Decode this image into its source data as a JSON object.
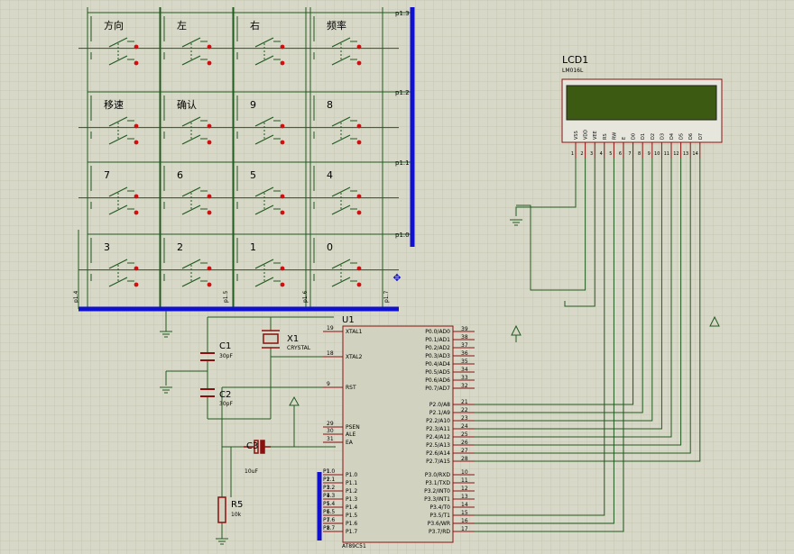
{
  "colors": {
    "background": "#d8d8c8",
    "grid": "#c6c6b4",
    "wire": "#1f5a1f",
    "bus": "#1010d0",
    "component": "#8a1010",
    "chip_fill": "#d2d2c0",
    "lcd_frame": "#e6e6dc",
    "lcd_screen": "#3d5a12",
    "contact": "#d01010"
  },
  "keypad": {
    "keys": [
      [
        "方向",
        "左",
        "右",
        "频率"
      ],
      [
        "移速",
        "确认",
        "9",
        "8"
      ],
      [
        "7",
        "6",
        "5",
        "4"
      ],
      [
        "3",
        "2",
        "1",
        "0"
      ]
    ],
    "row_nets": [
      "p1.3",
      "p1.2",
      "p1.1",
      "p1.0"
    ],
    "col_nets": [
      "p1.4",
      "p1.5",
      "p1.6",
      "p1.7"
    ]
  },
  "lcd": {
    "ref": "LCD1",
    "part": "LM016L",
    "pins": [
      "VSS",
      "VDD",
      "VEE",
      "RS",
      "RW",
      "E",
      "D0",
      "D1",
      "D2",
      "D3",
      "D4",
      "D5",
      "D6",
      "D7"
    ],
    "pin_numbers": [
      "1",
      "2",
      "3",
      "4",
      "5",
      "6",
      "7",
      "8",
      "9",
      "10",
      "11",
      "12",
      "13",
      "14"
    ]
  },
  "mcu": {
    "ref": "U1",
    "part": "AT89C51",
    "left_pins": [
      {
        "num": "19",
        "name": "XTAL1"
      },
      {
        "num": "18",
        "name": "XTAL2"
      },
      {
        "num": "9",
        "name": "RST"
      },
      {
        "num": "29",
        "name": "PSEN"
      },
      {
        "num": "30",
        "name": "ALE"
      },
      {
        "num": "31",
        "name": "EA"
      },
      {
        "num": "1",
        "name": "P1.0"
      },
      {
        "num": "2",
        "name": "P1.1"
      },
      {
        "num": "3",
        "name": "P1.2"
      },
      {
        "num": "4",
        "name": "P1.3"
      },
      {
        "num": "5",
        "name": "P1.4"
      },
      {
        "num": "6",
        "name": "P1.5"
      },
      {
        "num": "7",
        "name": "P1.6"
      },
      {
        "num": "8",
        "name": "P1.7"
      }
    ],
    "right_pins": [
      {
        "num": "39",
        "name": "P0.0/AD0"
      },
      {
        "num": "38",
        "name": "P0.1/AD1"
      },
      {
        "num": "37",
        "name": "P0.2/AD2"
      },
      {
        "num": "36",
        "name": "P0.3/AD3"
      },
      {
        "num": "35",
        "name": "P0.4/AD4"
      },
      {
        "num": "34",
        "name": "P0.5/AD5"
      },
      {
        "num": "33",
        "name": "P0.6/AD6"
      },
      {
        "num": "32",
        "name": "P0.7/AD7"
      },
      {
        "num": "21",
        "name": "P2.0/A8"
      },
      {
        "num": "22",
        "name": "P2.1/A9"
      },
      {
        "num": "23",
        "name": "P2.2/A10"
      },
      {
        "num": "24",
        "name": "P2.3/A11"
      },
      {
        "num": "25",
        "name": "P2.4/A12"
      },
      {
        "num": "26",
        "name": "P2.5/A13"
      },
      {
        "num": "27",
        "name": "P2.6/A14"
      },
      {
        "num": "28",
        "name": "P2.7/A15"
      },
      {
        "num": "10",
        "name": "P3.0/RXD"
      },
      {
        "num": "11",
        "name": "P3.1/TXD"
      },
      {
        "num": "12",
        "name": "P3.2/INT0"
      },
      {
        "num": "13",
        "name": "P3.3/INT1"
      },
      {
        "num": "14",
        "name": "P3.4/T0"
      },
      {
        "num": "15",
        "name": "P3.5/T1"
      },
      {
        "num": "16",
        "name": "P3.6/WR"
      },
      {
        "num": "17",
        "name": "P3.7/RD"
      }
    ],
    "bus_labels": [
      "P1.0",
      "P1.1",
      "P1.2",
      "P1.3",
      "P1.4",
      "P1.5",
      "P1.6",
      "P1.7"
    ]
  },
  "crystal": {
    "ref": "X1",
    "part": "CRYSTAL"
  },
  "caps": [
    {
      "ref": "C1",
      "value": "30pF"
    },
    {
      "ref": "C2",
      "value": "30pF"
    },
    {
      "ref": "C3",
      "value": "10uF"
    }
  ],
  "resistor": {
    "ref": "R5",
    "value": "10k"
  }
}
